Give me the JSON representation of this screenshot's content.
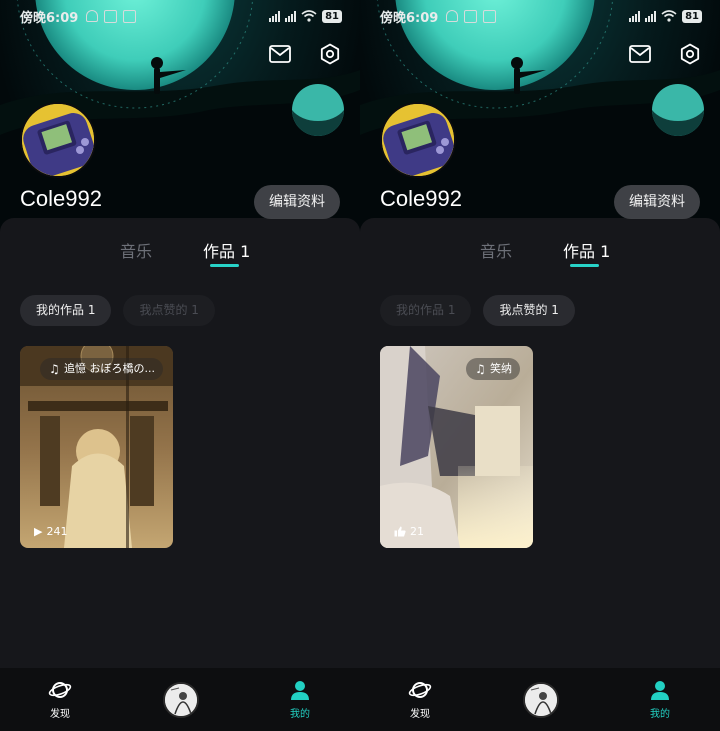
{
  "status_bar": {
    "time": "傍晚6:09",
    "battery": "81"
  },
  "profile": {
    "username": "Cole992",
    "edit_label": "编辑资料"
  },
  "tabs": [
    {
      "label": "音乐"
    },
    {
      "label": "作品 1"
    }
  ],
  "chips": {
    "my_works": "我的作品 1",
    "liked": "我点赞的 1"
  },
  "left_card": {
    "music": "追憶 おぼろ橋の...",
    "plays": "241"
  },
  "right_card": {
    "music": "笑纳",
    "likes": "21"
  },
  "nav": {
    "discover": "发现",
    "mine": "我的"
  },
  "icons": [
    "mail-icon",
    "settings-icon",
    "planet-icon",
    "person-icon",
    "music-note-icon",
    "play-icon",
    "thumb-up-icon"
  ],
  "colors": {
    "accent": "#22d0c3",
    "background": "#141519"
  }
}
